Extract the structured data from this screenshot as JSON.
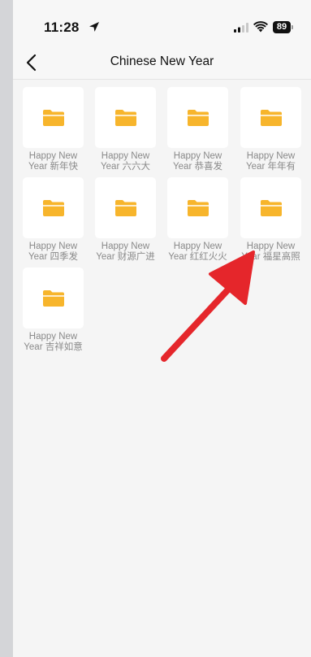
{
  "status_bar": {
    "time": "11:28",
    "battery_level": "89"
  },
  "nav": {
    "title": "Chinese New Year"
  },
  "folders": [
    {
      "label": "Happy New Year 新年快"
    },
    {
      "label": "Happy New Year 六六大"
    },
    {
      "label": "Happy New Year 恭喜发"
    },
    {
      "label": "Happy New Year 年年有"
    },
    {
      "label": "Happy New Year 四季发"
    },
    {
      "label": "Happy New Year 财源广进"
    },
    {
      "label": "Happy New Year 红红火火"
    },
    {
      "label": "Happy New Year 福星高照"
    },
    {
      "label": "Happy New Year 吉祥如意"
    }
  ],
  "colors": {
    "folder": "#f7b52c",
    "annotation_arrow": "#e5262b"
  }
}
